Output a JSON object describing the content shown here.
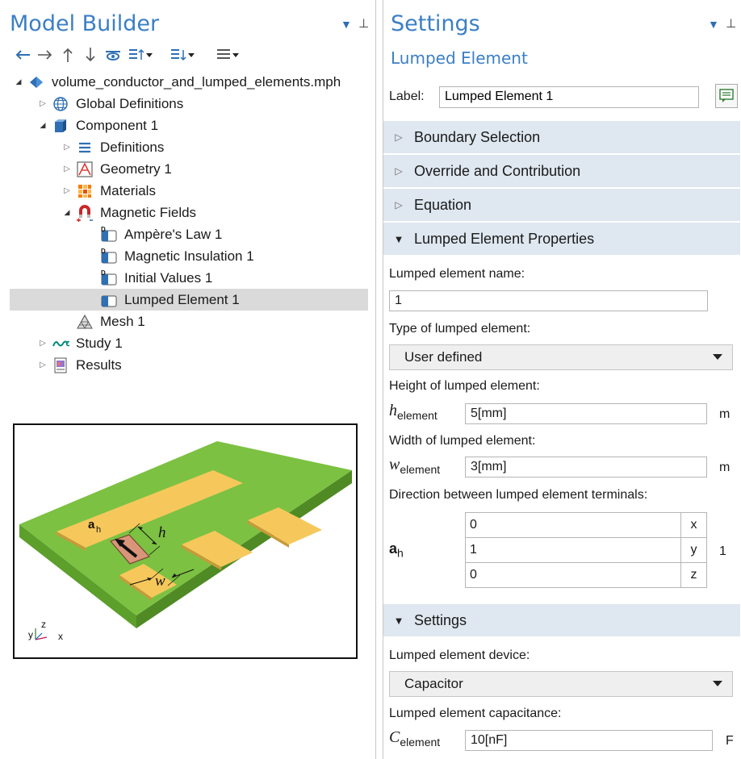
{
  "model_builder": {
    "title": "Model Builder",
    "tree": [
      {
        "label": "volume_conductor_and_lumped_elements.mph",
        "icon": "model-file-icon",
        "level": 0,
        "twisty": "open"
      },
      {
        "label": "Global Definitions",
        "icon": "globe-icon",
        "level": 1,
        "twisty": "closed"
      },
      {
        "label": "Component 1",
        "icon": "component-cube-icon",
        "level": 1,
        "twisty": "open"
      },
      {
        "label": "Definitions",
        "icon": "definitions-icon",
        "level": 2,
        "twisty": "closed"
      },
      {
        "label": "Geometry 1",
        "icon": "geometry-icon",
        "level": 2,
        "twisty": "closed"
      },
      {
        "label": "Materials",
        "icon": "materials-icon",
        "level": 2,
        "twisty": "closed"
      },
      {
        "label": "Magnetic Fields",
        "icon": "magnet-icon",
        "level": 2,
        "twisty": "open"
      },
      {
        "label": "Ampère's Law 1",
        "icon": "default-feature-icon",
        "level": 3,
        "twisty": "none"
      },
      {
        "label": "Magnetic Insulation 1",
        "icon": "default-feature-icon",
        "level": 3,
        "twisty": "none"
      },
      {
        "label": "Initial Values 1",
        "icon": "default-feature-icon",
        "level": 3,
        "twisty": "none"
      },
      {
        "label": "Lumped Element 1",
        "icon": "feature-icon",
        "level": 3,
        "twisty": "none",
        "selected": true
      },
      {
        "label": "Mesh 1",
        "icon": "mesh-icon",
        "level": 2,
        "twisty": "none"
      },
      {
        "label": "Study 1",
        "icon": "study-icon",
        "level": 1,
        "twisty": "closed"
      },
      {
        "label": "Results",
        "icon": "results-icon",
        "level": 1,
        "twisty": "closed"
      }
    ]
  },
  "figure": {
    "label_a": "a",
    "label_a_sub": "h",
    "label_h": "h",
    "label_w": "w",
    "axis_x": "x",
    "axis_y": "y",
    "axis_z": "z"
  },
  "settings": {
    "title": "Settings",
    "subtitle": "Lumped Element",
    "label_caption": "Label:",
    "label_value": "Lumped Element 1",
    "sections": {
      "boundary_selection": "Boundary Selection",
      "override": "Override and Contribution",
      "equation": "Equation",
      "properties": "Lumped Element Properties",
      "settings": "Settings"
    },
    "name_caption": "Lumped element name:",
    "name_value": "1",
    "type_caption": "Type of lumped element:",
    "type_value": "User defined",
    "height_caption": "Height of lumped element:",
    "height_symbol": "h",
    "height_symbol_sub": "element",
    "height_value": "5[mm]",
    "height_unit": "m",
    "width_caption": "Width of lumped element:",
    "width_symbol": "w",
    "width_symbol_sub": "element",
    "width_value": "3[mm]",
    "width_unit": "m",
    "direction_caption": "Direction between lumped element terminals:",
    "direction_symbol": "a",
    "direction_symbol_sub": "h",
    "direction": [
      {
        "value": "0",
        "component": "x"
      },
      {
        "value": "1",
        "component": "y"
      },
      {
        "value": "0",
        "component": "z"
      }
    ],
    "direction_unit": "1",
    "device_caption": "Lumped element device:",
    "device_value": "Capacitor",
    "capacitance_caption": "Lumped element capacitance:",
    "capacitance_symbol": "C",
    "capacitance_symbol_sub": "element",
    "capacitance_value": "10[nF]",
    "capacitance_unit": "F"
  },
  "colors": {
    "accent": "#3b7fc4",
    "section_bg": "#dfe7f0",
    "selected_row": "#dadada",
    "board_green": "#7cc142",
    "pad_gold": "#f6c85c",
    "lumped_element": "#d9957a"
  }
}
